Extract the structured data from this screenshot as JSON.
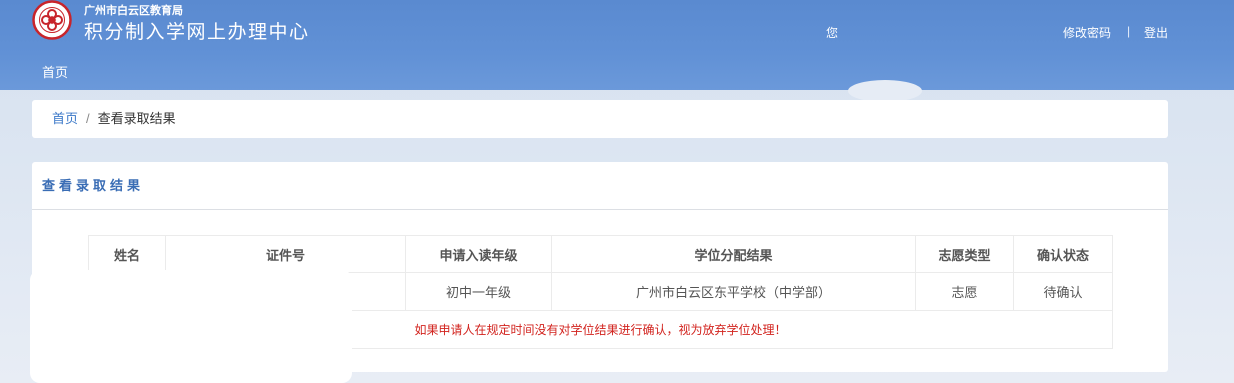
{
  "header": {
    "org": "广州市白云区教育局",
    "system_title": "积分制入学网上办理中心",
    "greeting": "您",
    "change_password": "修改密码",
    "separator": "|",
    "logout": "登出",
    "nav": [
      {
        "label": "首页"
      }
    ]
  },
  "breadcrumb": {
    "home": "首页",
    "separator": "/",
    "current": "查看录取结果"
  },
  "panel": {
    "title": "查看录取结果"
  },
  "table": {
    "columns": [
      "姓名",
      "证件号",
      "申请入读年级",
      "学位分配结果",
      "志愿类型",
      "确认状态"
    ],
    "rows": [
      {
        "grade": "初中一年级",
        "result": "广州市白云区东平学校（中学部）",
        "choice_type": "志愿",
        "status": "待确认"
      }
    ],
    "notice": "如果申请人在规定时间没有对学位结果进行确认，视为放弃学位处理！"
  },
  "icons": {
    "logo": "knot-emblem-icon"
  },
  "colors": {
    "header_blue": "#5b8cd2",
    "title_blue": "#3a6db5",
    "link_blue": "#3b78c8",
    "notice_red": "#d2231e"
  }
}
